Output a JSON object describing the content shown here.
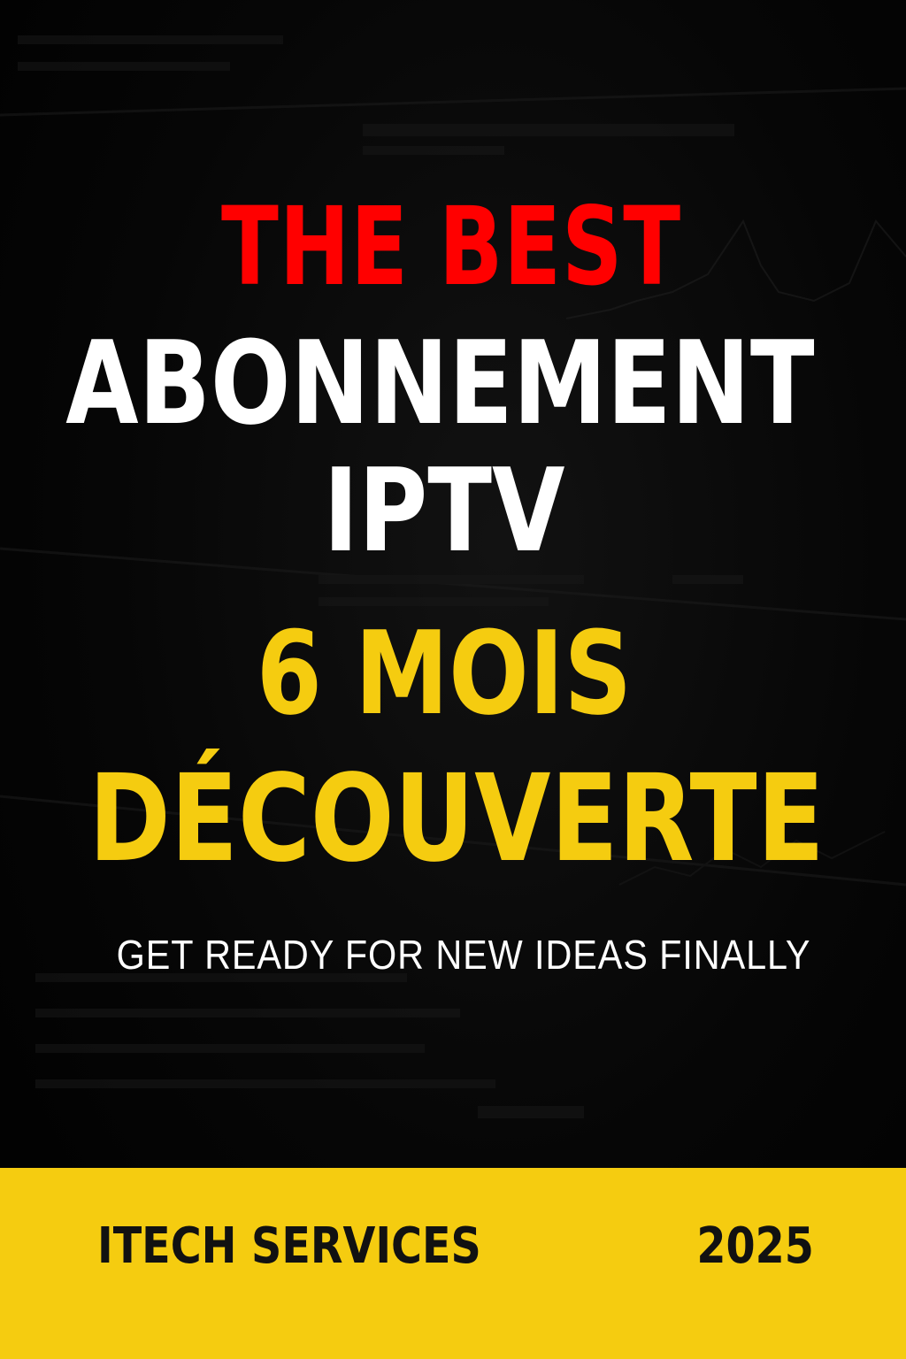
{
  "headline": {
    "line1": "THE BEST",
    "line2": "ABONNEMENT",
    "line3": "IPTV",
    "line4": "6 MOIS",
    "line5": "DÉCOUVERTE"
  },
  "tagline": "GET READY FOR NEW IDEAS FINALLY",
  "footer": {
    "brand": "ITECH SERVICES",
    "year": "2025"
  },
  "colors": {
    "accent_red": "#ff0000",
    "accent_yellow": "#f5cc10",
    "text_white": "#ffffff",
    "background": "#000000"
  }
}
